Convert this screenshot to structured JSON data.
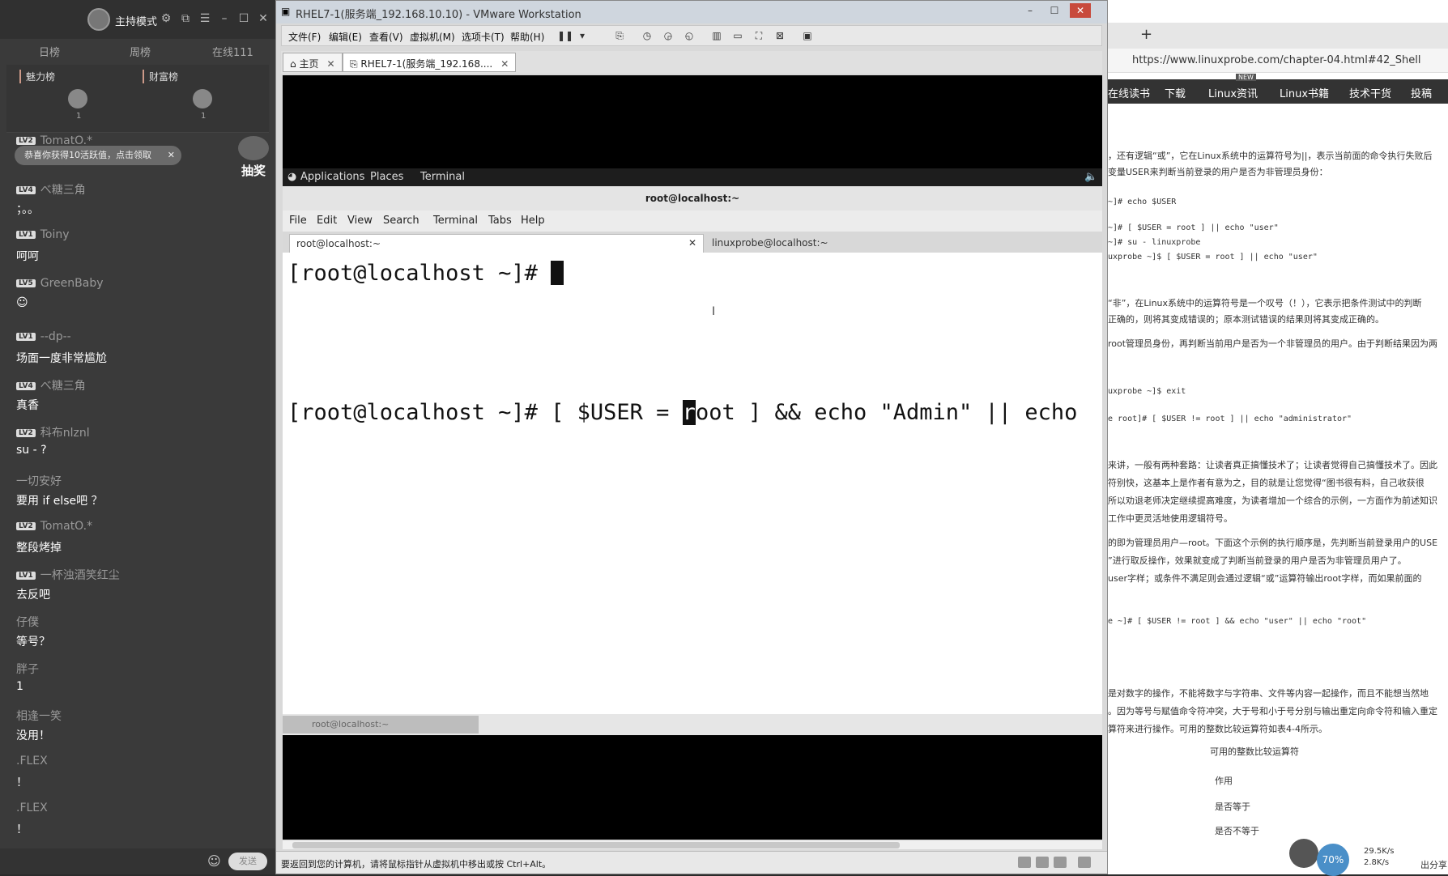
{
  "chat": {
    "mode": "主持模式",
    "tabs": [
      "日榜",
      "周榜",
      "在线111"
    ],
    "rank_labels": [
      "魅力榜",
      "财富榜"
    ],
    "rank_nums": [
      "1",
      "1"
    ],
    "notice": "恭喜你获得10活跃值，点击领取",
    "lottery": "抽奖",
    "send": "发送",
    "messages": [
      {
        "lv": "LV2",
        "name": "TomatO.*",
        "text": ""
      },
      {
        "lv": "LV4",
        "name": "べ糖三角",
        "text": "；。。"
      },
      {
        "lv": "LV1",
        "name": "Toiny",
        "text": "呵呵"
      },
      {
        "lv": "LV5",
        "name": "GreenBaby",
        "text": "☺"
      },
      {
        "lv": "LV1",
        "name": "--dp--",
        "text": "场面一度非常尴尬"
      },
      {
        "lv": "LV4",
        "name": "べ糖三角",
        "text": "真香"
      },
      {
        "lv": "LV2",
        "name": "科布nlznl",
        "text": "su - ?"
      },
      {
        "lv": "",
        "name": "一切安好",
        "text": "要用   if else吧 ？"
      },
      {
        "lv": "LV2",
        "name": "TomatO.*",
        "text": "整段烤掉"
      },
      {
        "lv": "LV1",
        "name": "一杯浊酒笑红尘",
        "text": "去反吧"
      },
      {
        "lv": "",
        "name": "仔僕",
        "text": "等号？"
      },
      {
        "lv": "",
        "name": "胖子",
        "text": "1"
      },
      {
        "lv": "",
        "name": "相逢一笑",
        "text": "没用！"
      },
      {
        "lv": "",
        "name": ".FLEX",
        "text": "！"
      },
      {
        "lv": "",
        "name": ".FLEX",
        "text": "！"
      }
    ]
  },
  "vmware": {
    "title": "RHEL7-1(服务端_192.168.10.10) - VMware Workstation",
    "menu": [
      "文件(F)",
      "编辑(E)",
      "查看(V)",
      "虚拟机(M)",
      "选项卡(T)",
      "帮助(H)"
    ],
    "tabs": [
      "主页",
      "RHEL7-1(服务端_192.168...."
    ],
    "status": "要返回到您的计算机，请将鼠标指针从虚拟机中移出或按 Ctrl+Alt。"
  },
  "gnome": {
    "applications": "Applications",
    "places": "Places",
    "terminal": "Terminal"
  },
  "terminal": {
    "title": "root@localhost:~",
    "menu": [
      "File",
      "Edit",
      "View",
      "Search",
      "Terminal",
      "Tabs",
      "Help"
    ],
    "tab_active": "root@localhost:~",
    "tab_other": "linuxprobe@localhost:~",
    "line1_prompt": "[root@localhost ~]# ",
    "line2_before": "[root@localhost ~]# [ $USER = ",
    "line2_hl": "r",
    "line2_after": "oot ] && echo \"Admin\" || echo",
    "taskbar": "root@localhost:~"
  },
  "browser": {
    "url": "https://www.linuxprobe.com/chapter-04.html#42_Shell",
    "nav": [
      "在线读书",
      "下载",
      "Linux资讯",
      "Linux书籍",
      "技术干货",
      "投稿"
    ],
    "nav_badge": "NEW",
    "doc_lines": [
      "，还有逻辑“或”，它在Linux系统中的运算符号为||，表示当前面的命令执行失败后",
      "变量USER来判断当前登录的用户是否为非管理员身份：",
      "~]# echo $USER",
      "~]# [ $USER = root ] || echo \"user\"",
      "~]# su - linuxprobe",
      "uxprobe ~]$ [ $USER = root ] || echo \"user\"",
      "“非”，在Linux系统中的运算符号是一个叹号（！），它表示把条件测试中的判断",
      "正确的，则将其变成错误的；原本测试错误的结果则将其变成正确的。",
      "root管理员身份，再判断当前用户是否为一个非管理员的用户。由于判断结果因为两",
      "uxprobe ~]$ exit",
      "e root]# [ $USER != root ] || echo \"administrator\"",
      "来讲，一般有两种套路：让读者真正搞懂技术了；让读者觉得自己搞懂技术了。因此",
      "符别快，这基本上是作者有意为之，目的就是让您觉得“图书很有料，自己收获很",
      "所以劝退老师决定继续提高难度，为读者增加一个综合的示例，一方面作为前述知识",
      "工作中更灵活地使用逻辑符号。",
      "的即为管理员用户—root。下面这个示例的执行顺序是，先判断当前登录用户的USE",
      "”进行取反操作，效果就变成了判断当前登录的用户是否为非管理员用户了。",
      "user字样；或条件不满足则会通过逻辑“或”运算符输出root字样，而如果前面的",
      "e ~]# [ $USER != root ] && echo \"user\" || echo \"root\"",
      "是对数字的操作，不能将数字与字符串、文件等内容一起操作，而且不能想当然地",
      "。因为等号与赋值命令符冲突，大于号和小于号分别与输出重定向命令符和输入重定",
      "算符来进行操作。可用的整数比较运算符如表4-4所示。",
      "可用的整数比较运算符",
      "作用",
      "是否等于",
      "是否不等于"
    ],
    "tray": {
      "percent": "70%",
      "up": "29.5K/s",
      "down": "2.8K/s",
      "share": "出分享"
    }
  }
}
